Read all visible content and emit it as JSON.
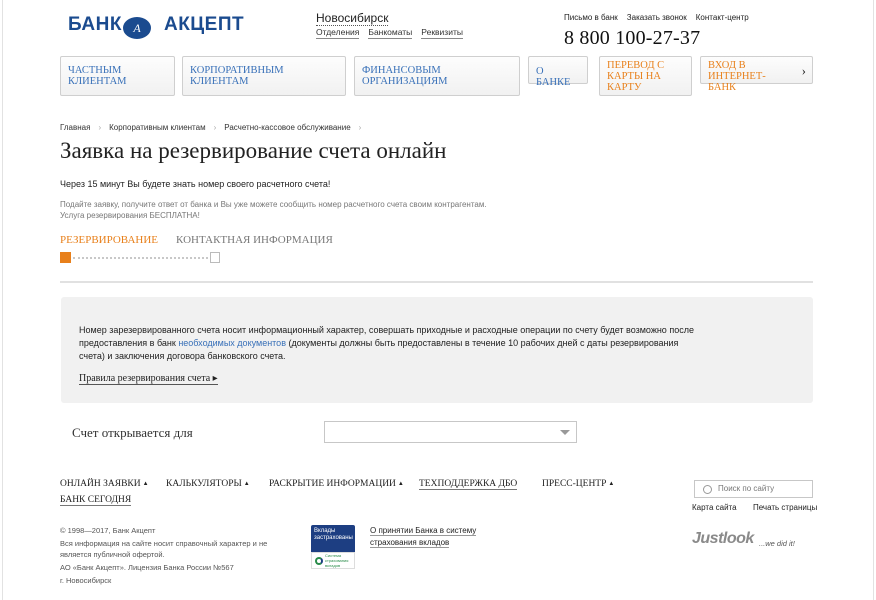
{
  "header": {
    "logo_text": "БАНК АКЦЕПТ",
    "logo_mark": "A",
    "city": "Новосибирск",
    "subnav": [
      "Отделения",
      "Банкоматы",
      "Реквизиты"
    ],
    "toplinks": [
      "Письмо в банк",
      "Заказать звонок",
      "Контакт-центр"
    ],
    "phone": "8 800 100-27-37"
  },
  "menu": {
    "private": "ЧАСТНЫМ КЛИЕНТАМ",
    "corporate": "КОРПОРАТИВНЫМ КЛИЕНТАМ",
    "financial": "ФИНАНСОВЫМ ОРГАНИЗАЦИЯМ",
    "about": "О БАНКЕ",
    "transfer": "ПЕРЕВОД С КАРТЫ НА КАРТУ",
    "ibank": "ВХОД В ИНТЕРНЕТ-БАНК",
    "ibank_chevron": "›"
  },
  "breadcrumb": [
    "Главная",
    "Корпоративным клиентам",
    "Расчетно-кассовое обслуживание"
  ],
  "breadcrumb_sep": "›",
  "page": {
    "title": "Заявка на резервирование счета онлайн",
    "lead": "Через 15 минут Вы будете знать номер своего расчетного счета!",
    "note1": "Подайте заявку, получите ответ от банка и Вы уже можете сообщить номер расчетного счета своим контрагентам.",
    "note2": "Услуга резервирования БЕСПЛАТНА!"
  },
  "tabs": {
    "active": "РЕЗЕРВИРОВАНИЕ",
    "inactive": "КОНТАКТНАЯ ИНФОРМАЦИЯ"
  },
  "progress": {
    "step": 1,
    "total": 2
  },
  "info": {
    "part1": "Номер зарезервированного счета носит информационный характер, совершать приходные и расходные операции по счету будет возможно после предоставления в банк ",
    "link": "необходимых документов",
    "part2": " (документы должны быть предоставлены в течение 10 рабочих дней с даты резервирования счета) и заключения договора банковского счета.",
    "rules_link": "Правила резервирования счета ▸"
  },
  "form": {
    "account_label": "Счет открывается для",
    "select_value": ""
  },
  "footer": {
    "nav1": "ОНЛАЙН ЗАЯВКИ",
    "nav2": "КАЛЬКУЛЯТОРЫ",
    "nav3": "РАСКРЫТИЕ ИНФОРМАЦИИ",
    "nav4": "ТЕХПОДДЕРЖКА ДБО",
    "nav5": "ПРЕСС-ЦЕНТР",
    "nav6": "БАНК СЕГОДНЯ",
    "tri": "▲",
    "search_placeholder": "Поиск по сайту",
    "sitemap": "Карта сайта",
    "print": "Печать страницы",
    "copy1": "© 1998—2017, Банк Акцепт",
    "copy2": "Вся информация на сайте носит справочный характер и не является публичной офертой.",
    "copy3": "АО «Банк Акцепт». Лицензия Банка России №567",
    "copy4": "г. Новосибирск",
    "badge_title": "Вклады застрахованы",
    "badge_sub": "Система страхования вкладов",
    "badge_text1": "О принятии Банка в систему",
    "badge_text2": "страхования вкладов",
    "justlook": "Justlook",
    "wedid": "...we did it!"
  },
  "colors": {
    "accent": "#e8801b",
    "link": "#3870b8",
    "brand": "#1b4b8f"
  }
}
